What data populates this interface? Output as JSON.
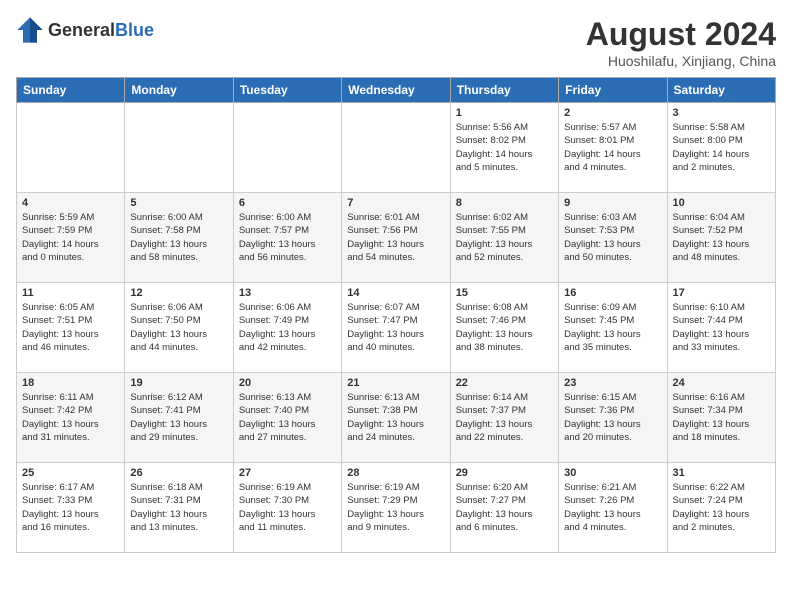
{
  "logo": {
    "general": "General",
    "blue": "Blue"
  },
  "title": {
    "month_year": "August 2024",
    "location": "Huoshilafu, Xinjiang, China"
  },
  "days_header": [
    "Sunday",
    "Monday",
    "Tuesday",
    "Wednesday",
    "Thursday",
    "Friday",
    "Saturday"
  ],
  "weeks": [
    [
      {
        "day": "",
        "info": ""
      },
      {
        "day": "",
        "info": ""
      },
      {
        "day": "",
        "info": ""
      },
      {
        "day": "",
        "info": ""
      },
      {
        "day": "1",
        "info": "Sunrise: 5:56 AM\nSunset: 8:02 PM\nDaylight: 14 hours\nand 5 minutes."
      },
      {
        "day": "2",
        "info": "Sunrise: 5:57 AM\nSunset: 8:01 PM\nDaylight: 14 hours\nand 4 minutes."
      },
      {
        "day": "3",
        "info": "Sunrise: 5:58 AM\nSunset: 8:00 PM\nDaylight: 14 hours\nand 2 minutes."
      }
    ],
    [
      {
        "day": "4",
        "info": "Sunrise: 5:59 AM\nSunset: 7:59 PM\nDaylight: 14 hours\nand 0 minutes."
      },
      {
        "day": "5",
        "info": "Sunrise: 6:00 AM\nSunset: 7:58 PM\nDaylight: 13 hours\nand 58 minutes."
      },
      {
        "day": "6",
        "info": "Sunrise: 6:00 AM\nSunset: 7:57 PM\nDaylight: 13 hours\nand 56 minutes."
      },
      {
        "day": "7",
        "info": "Sunrise: 6:01 AM\nSunset: 7:56 PM\nDaylight: 13 hours\nand 54 minutes."
      },
      {
        "day": "8",
        "info": "Sunrise: 6:02 AM\nSunset: 7:55 PM\nDaylight: 13 hours\nand 52 minutes."
      },
      {
        "day": "9",
        "info": "Sunrise: 6:03 AM\nSunset: 7:53 PM\nDaylight: 13 hours\nand 50 minutes."
      },
      {
        "day": "10",
        "info": "Sunrise: 6:04 AM\nSunset: 7:52 PM\nDaylight: 13 hours\nand 48 minutes."
      }
    ],
    [
      {
        "day": "11",
        "info": "Sunrise: 6:05 AM\nSunset: 7:51 PM\nDaylight: 13 hours\nand 46 minutes."
      },
      {
        "day": "12",
        "info": "Sunrise: 6:06 AM\nSunset: 7:50 PM\nDaylight: 13 hours\nand 44 minutes."
      },
      {
        "day": "13",
        "info": "Sunrise: 6:06 AM\nSunset: 7:49 PM\nDaylight: 13 hours\nand 42 minutes."
      },
      {
        "day": "14",
        "info": "Sunrise: 6:07 AM\nSunset: 7:47 PM\nDaylight: 13 hours\nand 40 minutes."
      },
      {
        "day": "15",
        "info": "Sunrise: 6:08 AM\nSunset: 7:46 PM\nDaylight: 13 hours\nand 38 minutes."
      },
      {
        "day": "16",
        "info": "Sunrise: 6:09 AM\nSunset: 7:45 PM\nDaylight: 13 hours\nand 35 minutes."
      },
      {
        "day": "17",
        "info": "Sunrise: 6:10 AM\nSunset: 7:44 PM\nDaylight: 13 hours\nand 33 minutes."
      }
    ],
    [
      {
        "day": "18",
        "info": "Sunrise: 6:11 AM\nSunset: 7:42 PM\nDaylight: 13 hours\nand 31 minutes."
      },
      {
        "day": "19",
        "info": "Sunrise: 6:12 AM\nSunset: 7:41 PM\nDaylight: 13 hours\nand 29 minutes."
      },
      {
        "day": "20",
        "info": "Sunrise: 6:13 AM\nSunset: 7:40 PM\nDaylight: 13 hours\nand 27 minutes."
      },
      {
        "day": "21",
        "info": "Sunrise: 6:13 AM\nSunset: 7:38 PM\nDaylight: 13 hours\nand 24 minutes."
      },
      {
        "day": "22",
        "info": "Sunrise: 6:14 AM\nSunset: 7:37 PM\nDaylight: 13 hours\nand 22 minutes."
      },
      {
        "day": "23",
        "info": "Sunrise: 6:15 AM\nSunset: 7:36 PM\nDaylight: 13 hours\nand 20 minutes."
      },
      {
        "day": "24",
        "info": "Sunrise: 6:16 AM\nSunset: 7:34 PM\nDaylight: 13 hours\nand 18 minutes."
      }
    ],
    [
      {
        "day": "25",
        "info": "Sunrise: 6:17 AM\nSunset: 7:33 PM\nDaylight: 13 hours\nand 16 minutes."
      },
      {
        "day": "26",
        "info": "Sunrise: 6:18 AM\nSunset: 7:31 PM\nDaylight: 13 hours\nand 13 minutes."
      },
      {
        "day": "27",
        "info": "Sunrise: 6:19 AM\nSunset: 7:30 PM\nDaylight: 13 hours\nand 11 minutes."
      },
      {
        "day": "28",
        "info": "Sunrise: 6:19 AM\nSunset: 7:29 PM\nDaylight: 13 hours\nand 9 minutes."
      },
      {
        "day": "29",
        "info": "Sunrise: 6:20 AM\nSunset: 7:27 PM\nDaylight: 13 hours\nand 6 minutes."
      },
      {
        "day": "30",
        "info": "Sunrise: 6:21 AM\nSunset: 7:26 PM\nDaylight: 13 hours\nand 4 minutes."
      },
      {
        "day": "31",
        "info": "Sunrise: 6:22 AM\nSunset: 7:24 PM\nDaylight: 13 hours\nand 2 minutes."
      }
    ]
  ]
}
